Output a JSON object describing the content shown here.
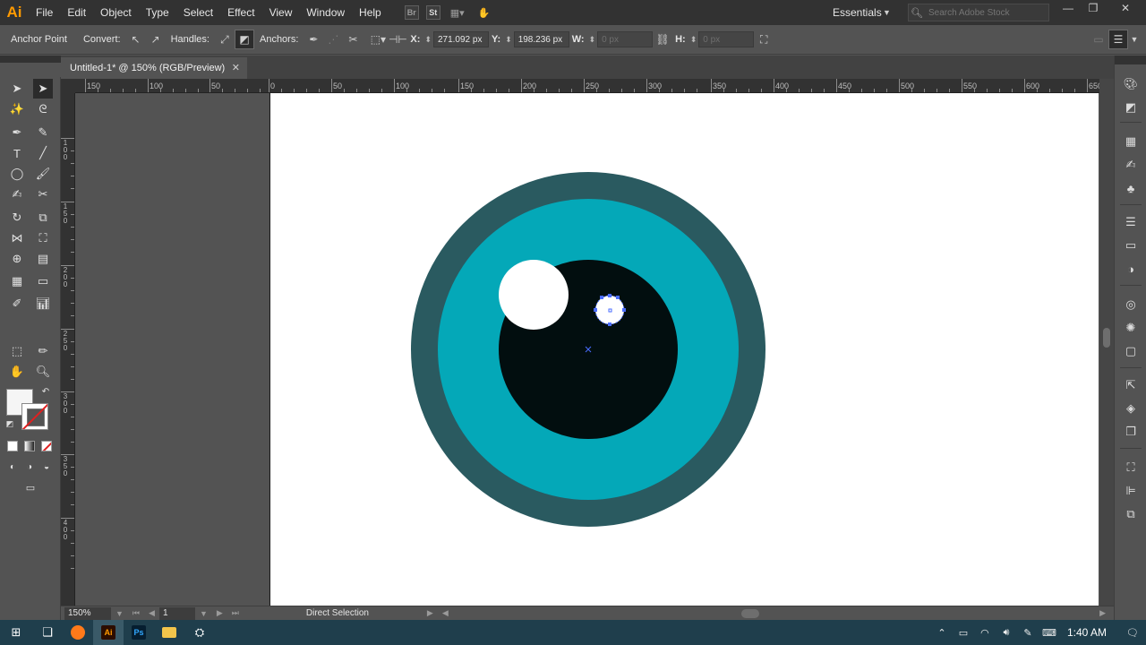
{
  "menubar": {
    "app_logo": "Ai",
    "menus": [
      "File",
      "Edit",
      "Object",
      "Type",
      "Select",
      "Effect",
      "View",
      "Window",
      "Help"
    ],
    "bridge_label": "Br",
    "stock_label": "St",
    "workspace": "Essentials",
    "search_placeholder": "Search Adobe Stock"
  },
  "controlbar": {
    "mode_label": "Anchor Point",
    "convert_label": "Convert:",
    "handles_label": "Handles:",
    "anchors_label": "Anchors:",
    "x_label": "X:",
    "x_value": "271.092 px",
    "y_label": "Y:",
    "y_value": "198.236 px",
    "w_label": "W:",
    "w_value": "0 px",
    "h_label": "H:",
    "h_value": "0 px"
  },
  "document": {
    "tab_title": "Untitled-1* @ 150% (RGB/Preview)",
    "close_glyph": "✕"
  },
  "rulers": {
    "top_labels": [
      "150",
      "100",
      "50",
      "0",
      "50",
      "100",
      "150",
      "200",
      "250",
      "300",
      "350",
      "400",
      "450",
      "500",
      "550",
      "600",
      "650"
    ],
    "left_labels": [
      "1\n0\n0",
      "1\n5\n0",
      "2\n0\n0",
      "2\n5\n0",
      "3\n0\n0",
      "3\n5\n0",
      "4\n0\n0"
    ]
  },
  "artwork": {
    "outer_ring_color": "#2a5a60",
    "iris_color": "#04a8b8",
    "pupil_color": "#020e0f",
    "highlight_color": "#ffffff",
    "selection_color": "#4a6cff"
  },
  "statusbar": {
    "zoom": "150%",
    "page": "1",
    "tool_name": "Direct Selection"
  },
  "taskbar": {
    "clock": "1:40 AM",
    "apps": [
      "windows-start",
      "task-view",
      "firefox",
      "illustrator",
      "photoshop",
      "file-explorer",
      "network-tool"
    ],
    "illustrator_label": "Ai",
    "photoshop_label": "Ps"
  }
}
